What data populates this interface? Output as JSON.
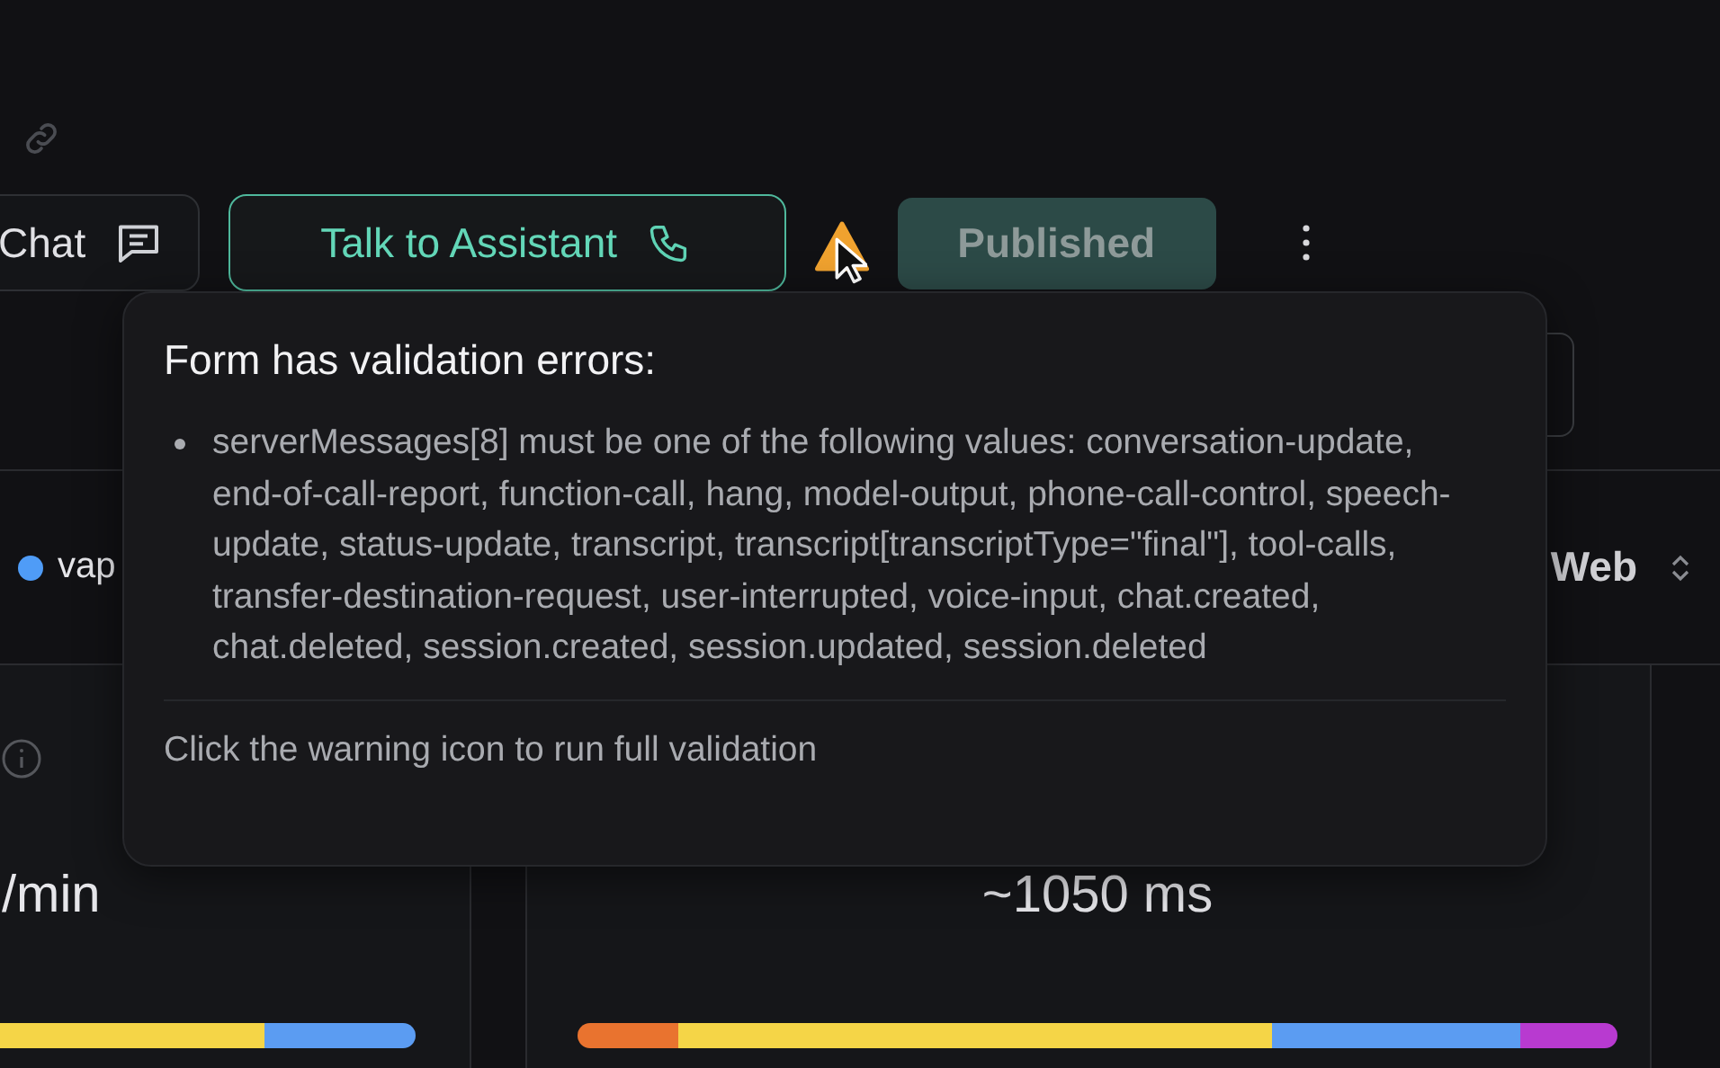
{
  "toolbar": {
    "chat_button": "Chat",
    "talk_button": "Talk to Assistant",
    "status_button": {
      "label": "Published",
      "disabled": true
    }
  },
  "filter_row": {
    "provider": {
      "label": "vap",
      "color": "#4f9cf7"
    },
    "channel_select": "Web"
  },
  "metrics": [
    {
      "value": "/min",
      "segments": [
        {
          "color": "#f5d547"
        },
        {
          "color": "#5b9cf2"
        }
      ]
    },
    {
      "value": "~1050 ms",
      "segments": [
        {
          "color": "#e9732f"
        },
        {
          "color": "#f5d547"
        },
        {
          "color": "#5b9cf2"
        },
        {
          "color": "#b83ad0"
        }
      ]
    }
  ],
  "tooltip": {
    "title": "Form has validation errors:",
    "errors": [
      "serverMessages[8] must be one of the following values: conversation-update, end-of-call-report, function-call, hang, model-output, phone-call-control, speech-update, status-update, transcript, transcript[transcriptType=\"final\"], tool-calls, transfer-destination-request, user-interrupted, voice-input, chat.created, chat.deleted, session.created, session.updated, session.deleted"
    ],
    "footer": "Click the warning icon to run full validation"
  }
}
